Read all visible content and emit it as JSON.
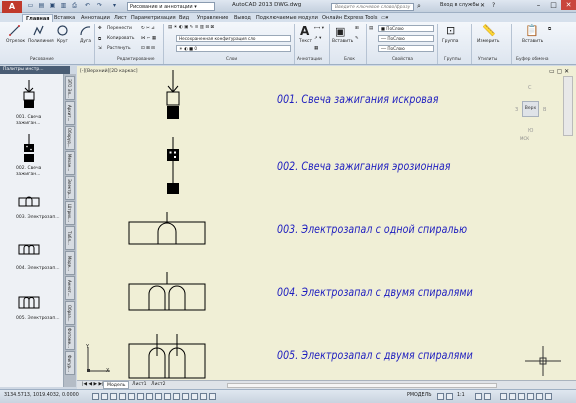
{
  "titlebar": {
    "workspace": "Рисование и аннотации",
    "app_title": "AutoCAD 2013    DWG.dwg",
    "search_placeholder": "Введите ключевое слово/фразу",
    "signin": "Вход в службы"
  },
  "ribbon_tabs": [
    "Главная",
    "Вставка",
    "Аннотации",
    "Лист",
    "Параметризация",
    "Вид",
    "Управление",
    "Вывод",
    "Подключаемые модули",
    "Онлайн",
    "Express Tools"
  ],
  "ribbon": {
    "draw": {
      "polyline": "Отрезок",
      "line": "Полилиния",
      "circle": "Круг",
      "arc": "Дуга",
      "panel": "Рисование"
    },
    "modify": {
      "move": "Перенести",
      "copy": "Копировать",
      "stretch": "Растянуть",
      "panel": "Редактирование"
    },
    "layers": {
      "layer_state": "Несохраненная конфигурация сло",
      "layer_value": "0",
      "panel": "Слои"
    },
    "annotation": {
      "text": "Текст",
      "panel": "Аннотации"
    },
    "block": {
      "insert": "Вставить",
      "panel": "Блок"
    },
    "properties": {
      "bylayer1": "ПоСлою",
      "bylayer2": "ПоСлою",
      "bylayer3": "ПоСлою",
      "panel": "Свойства"
    },
    "groups": {
      "group": "Группа",
      "panel": "Группы"
    },
    "utilities": {
      "measure": "Измерить",
      "panel": "Утилиты"
    },
    "clipboard": {
      "paste": "Вставить",
      "panel": "Буфер обмена"
    }
  },
  "palette": {
    "title": "Палитры инстр...",
    "items": [
      {
        "label": "001. Свеча зажиган..."
      },
      {
        "label": "002. Свеча зажиган..."
      },
      {
        "label": "003. Электрозап..."
      },
      {
        "label": "004. Электрозап..."
      },
      {
        "label": "005. Электрозап..."
      }
    ],
    "tabs": [
      "ЭТО Эл...",
      "Архит...",
      "Оборуд...",
      "Механ...",
      "Электр...",
      "Штрих...",
      "Табл...",
      "Моде...",
      "Аннот...",
      "Образ...",
      "Фотоме...",
      "Фигур..."
    ]
  },
  "drawing": {
    "view_label": "[-][Верхний][2D каркас]",
    "texts": [
      "001. Свеча зажигания искровая",
      "002. Свеча зажигания эрозионная",
      "003. Электрозапал с одной спиралью",
      "004. Электрозапал с двумя спиралями",
      "005. Электрозапал с двумя спиралями"
    ],
    "viewcube": {
      "top": "Верх",
      "n": "С",
      "s": "Ю",
      "w": "З",
      "e": "В",
      "wcs": "МСК"
    },
    "ucs": {
      "x": "X",
      "y": "Y"
    }
  },
  "layout_tabs": [
    "Модель",
    "Лист1",
    "Лист2"
  ],
  "statusbar": {
    "coords": "3134.5713, 1019.4032, 0.0000",
    "model": "РМОДЕЛЬ",
    "scale": "1:1"
  },
  "colors": {
    "text_blue": "#1d1dbf",
    "paper": "#f0efd6",
    "ribbon": "#e7edf5"
  }
}
